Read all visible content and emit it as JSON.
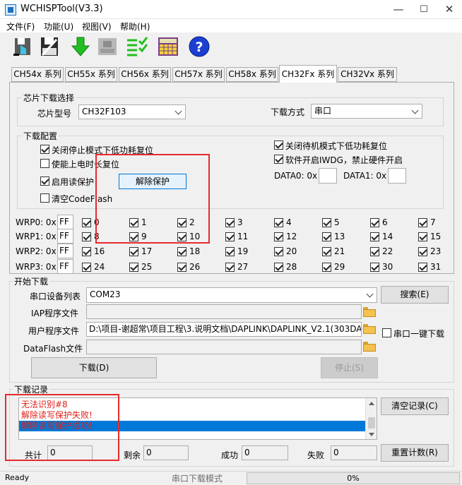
{
  "window": {
    "title": "WCHISPTool(V3.3)",
    "minimize": "—",
    "maximize": "☐",
    "close": "✕"
  },
  "menu": [
    "文件(F)",
    "功能(U)",
    "视图(V)",
    "帮助(H)"
  ],
  "toolbar": {
    "icons": [
      "open-chip-icon",
      "save-config-icon",
      "download-icon",
      "chip-info-icon",
      "verify-list-icon",
      "calculator-icon",
      "help-icon"
    ],
    "help_glyph": "?"
  },
  "tabs": [
    "CH54x 系列",
    "CH55x 系列",
    "CH56x 系列",
    "CH57x 系列",
    "CH58x 系列",
    "CH32Fx 系列",
    "CH32Vx 系列"
  ],
  "active_tab": 5,
  "chip_select": {
    "group_title": "芯片下载选择",
    "model_label": "芯片型号",
    "model_value": "CH32F103",
    "mode_label": "下载方式",
    "mode_value": "串口"
  },
  "download_config": {
    "group_title": "下载配置",
    "opt_stop_lowpower": "关闭停止模式下低功耗复位",
    "opt_poweron_reset": "使能上电时长复位",
    "opt_read_protect": "启用读保护",
    "opt_clear_codeflash": "清空CodeFlash",
    "unprotect_button": "解除保护",
    "opt_standby_lowpower": "关闭待机模式下低功耗复位",
    "opt_iwdg": "软件开启IWDG，禁止硬件开启",
    "data0_label": "DATA0: 0x",
    "data1_label": "DATA1: 0x",
    "data0_value": "",
    "data1_value": ""
  },
  "wrp": {
    "rows": [
      {
        "label": "WRP0: 0x",
        "value": "FF",
        "bits": [
          "0",
          "1",
          "2",
          "3",
          "4",
          "5",
          "6",
          "7"
        ]
      },
      {
        "label": "WRP1: 0x",
        "value": "FF",
        "bits": [
          "8",
          "9",
          "10",
          "11",
          "12",
          "13",
          "14",
          "15"
        ]
      },
      {
        "label": "WRP2: 0x",
        "value": "FF",
        "bits": [
          "16",
          "17",
          "18",
          "19",
          "20",
          "21",
          "22",
          "23"
        ]
      },
      {
        "label": "WRP3: 0x",
        "value": "FF",
        "bits": [
          "24",
          "25",
          "26",
          "27",
          "28",
          "29",
          "30",
          "31"
        ]
      }
    ]
  },
  "start": {
    "group_title": "开始下载",
    "port_label": "串口设备列表",
    "port_value": "COM23",
    "search_button": "搜索(E)",
    "iap_label": "IAP程序文件",
    "iap_value": "",
    "user_label": "用户程序文件",
    "user_value": "D:\\项目-谢超常\\项目工程\\3.说明文档\\DAPLINK\\DAPLINK_V2.1(303DAPL",
    "dataflash_label": "DataFlash文件",
    "dataflash_value": "",
    "oneclick_label": "串口一键下载",
    "download_button": "下载(D)",
    "stop_button": "停止(S)"
  },
  "log": {
    "group_title": "下载记录",
    "lines": [
      "无法识别#8",
      "解除读写保护失败!",
      "解除读写保护成功!"
    ],
    "selected_line": 2,
    "clear_button": "清空记录(C)",
    "total_label": "共计",
    "total_value": "0",
    "remaining_label": "剩余",
    "remaining_value": "0",
    "success_label": "成功",
    "success_value": "0",
    "fail_label": "失败",
    "fail_value": "0",
    "reset_button": "重置计数(R)"
  },
  "status": {
    "ready": "Ready",
    "mode": "串口下载模式",
    "progress": "0%",
    "progress_fraction": 0
  },
  "colors": {
    "accent": "#0078d7",
    "error_text": "#e0201a",
    "annotation": "#e52b2b",
    "selection": "#0078d7"
  }
}
